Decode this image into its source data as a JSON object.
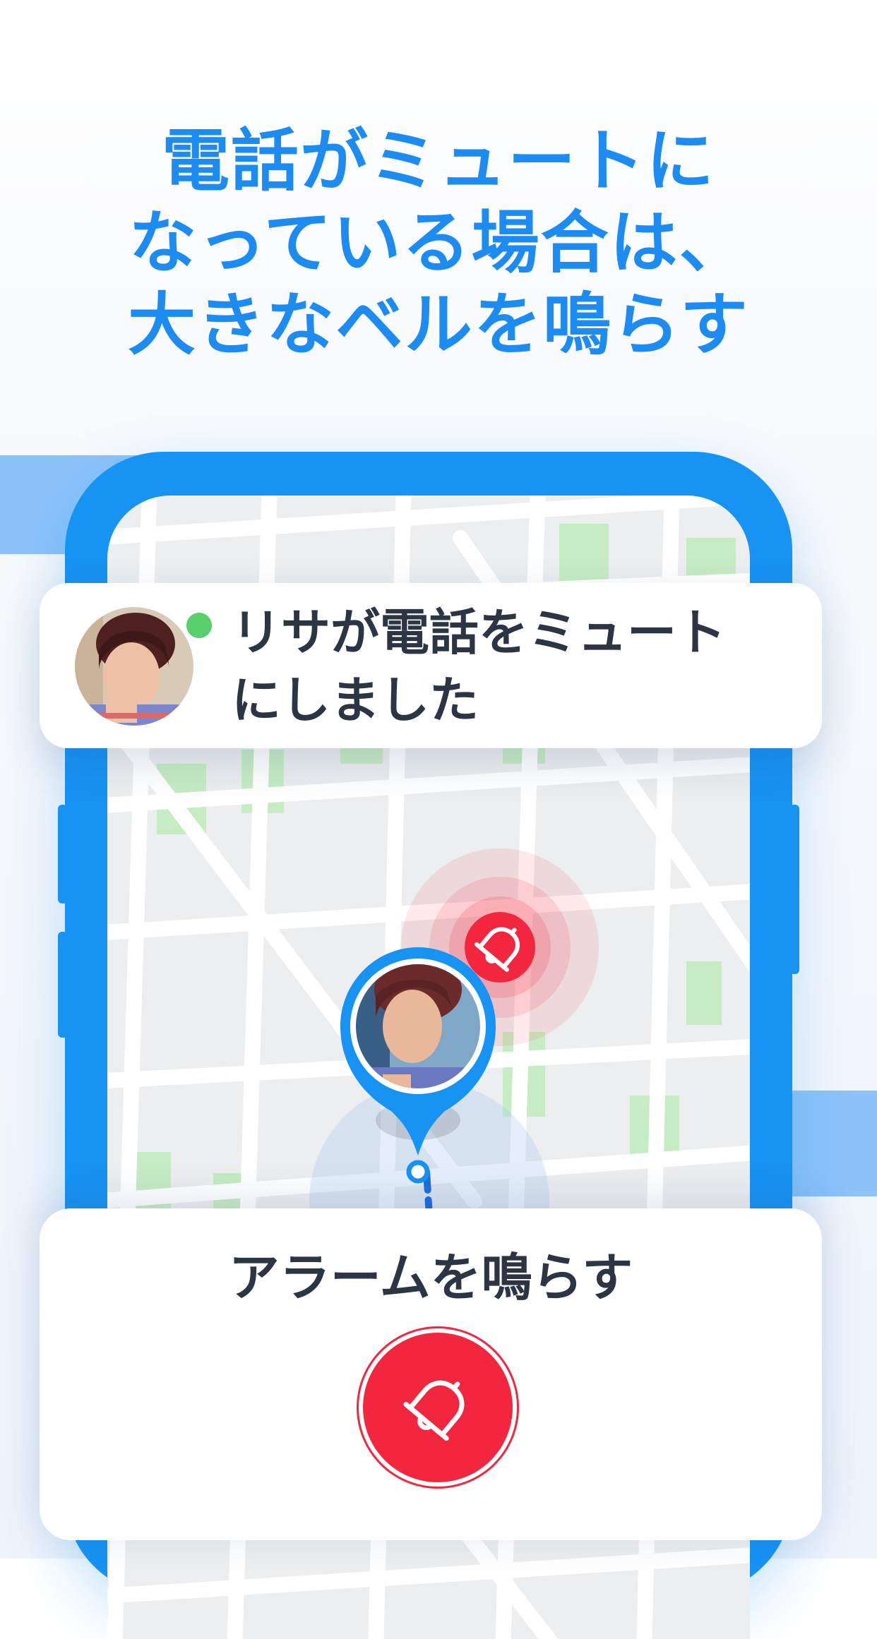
{
  "headline": {
    "lines": [
      "電話がミュートに",
      "なっている場合は、",
      "大きなベルを鳴らす"
    ]
  },
  "notification": {
    "lines": [
      "リサが電話をミュート",
      "にしました"
    ],
    "status": "online"
  },
  "action": {
    "title": "アラームを鳴らす",
    "button_icon": "bell-icon"
  },
  "map": {
    "pin_icon": "location-pin",
    "alert_icon": "bell-icon"
  },
  "colors": {
    "accent": "#1793f3",
    "headline": "#1d8cf2",
    "alert": "#f2273f",
    "online": "#57cf6b",
    "text": "#2b3544"
  }
}
